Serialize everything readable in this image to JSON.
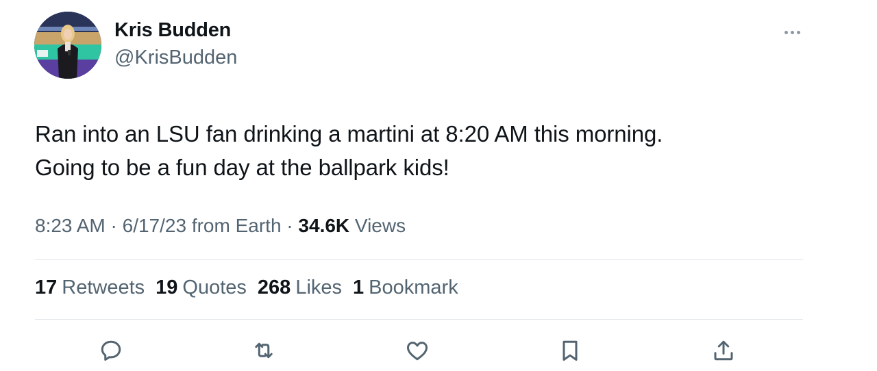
{
  "author": {
    "display_name": "Kris Budden",
    "handle": "@KrisBudden"
  },
  "tweet": {
    "lines": [
      "Ran into an LSU fan drinking a martini at 8:20 AM this morning.",
      "Going to be a fun day at the ballpark kids!"
    ]
  },
  "meta": {
    "time": "8:23 AM",
    "sep1": " · ",
    "date": "6/17/23",
    "source": " from Earth",
    "sep2": " · ",
    "views_count": "34.6K",
    "views_label": " Views"
  },
  "stats": [
    {
      "count": "17",
      "label": "Retweets"
    },
    {
      "count": "19",
      "label": "Quotes"
    },
    {
      "count": "268",
      "label": "Likes"
    },
    {
      "count": "1",
      "label": "Bookmark"
    }
  ],
  "icons": {
    "more": "more-horizontal-icon",
    "reply": "reply-icon",
    "retweet": "retweet-icon",
    "like": "heart-icon",
    "bookmark": "bookmark-icon",
    "share": "share-icon"
  },
  "colors": {
    "text": "#0f1419",
    "secondary": "#536471",
    "divider": "#e1e5e9"
  }
}
